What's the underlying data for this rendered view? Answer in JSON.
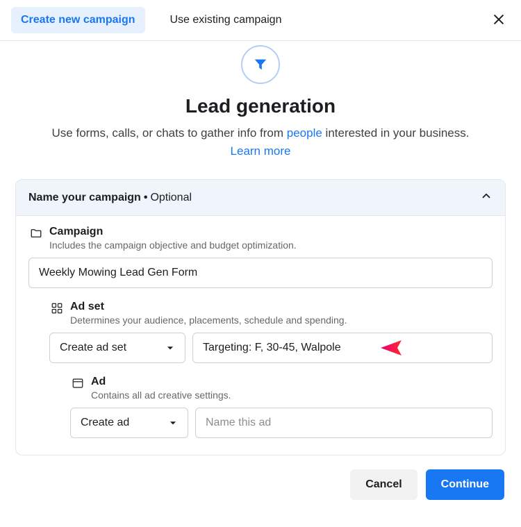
{
  "tabs": {
    "create": "Create new campaign",
    "existing": "Use existing campaign"
  },
  "hero": {
    "title": "Lead generation",
    "desc_pre": "Use forms, calls, or chats to gather info from ",
    "desc_link_people": "people",
    "desc_mid": " interested in your business. ",
    "desc_learn": "Learn more"
  },
  "card": {
    "header_prefix": "Name your campaign",
    "header_suffix": "Optional"
  },
  "campaign": {
    "title": "Campaign",
    "desc": "Includes the campaign objective and budget optimization.",
    "value": "Weekly Mowing Lead Gen Form"
  },
  "adset": {
    "title": "Ad set",
    "desc": "Determines your audience, placements, schedule and spending.",
    "dropdown_label": "Create ad set",
    "value": "Targeting: F, 30-45, Walpole"
  },
  "ad": {
    "title": "Ad",
    "desc": "Contains all ad creative settings.",
    "dropdown_label": "Create ad",
    "placeholder": "Name this ad"
  },
  "footer": {
    "cancel": "Cancel",
    "continue": "Continue"
  }
}
